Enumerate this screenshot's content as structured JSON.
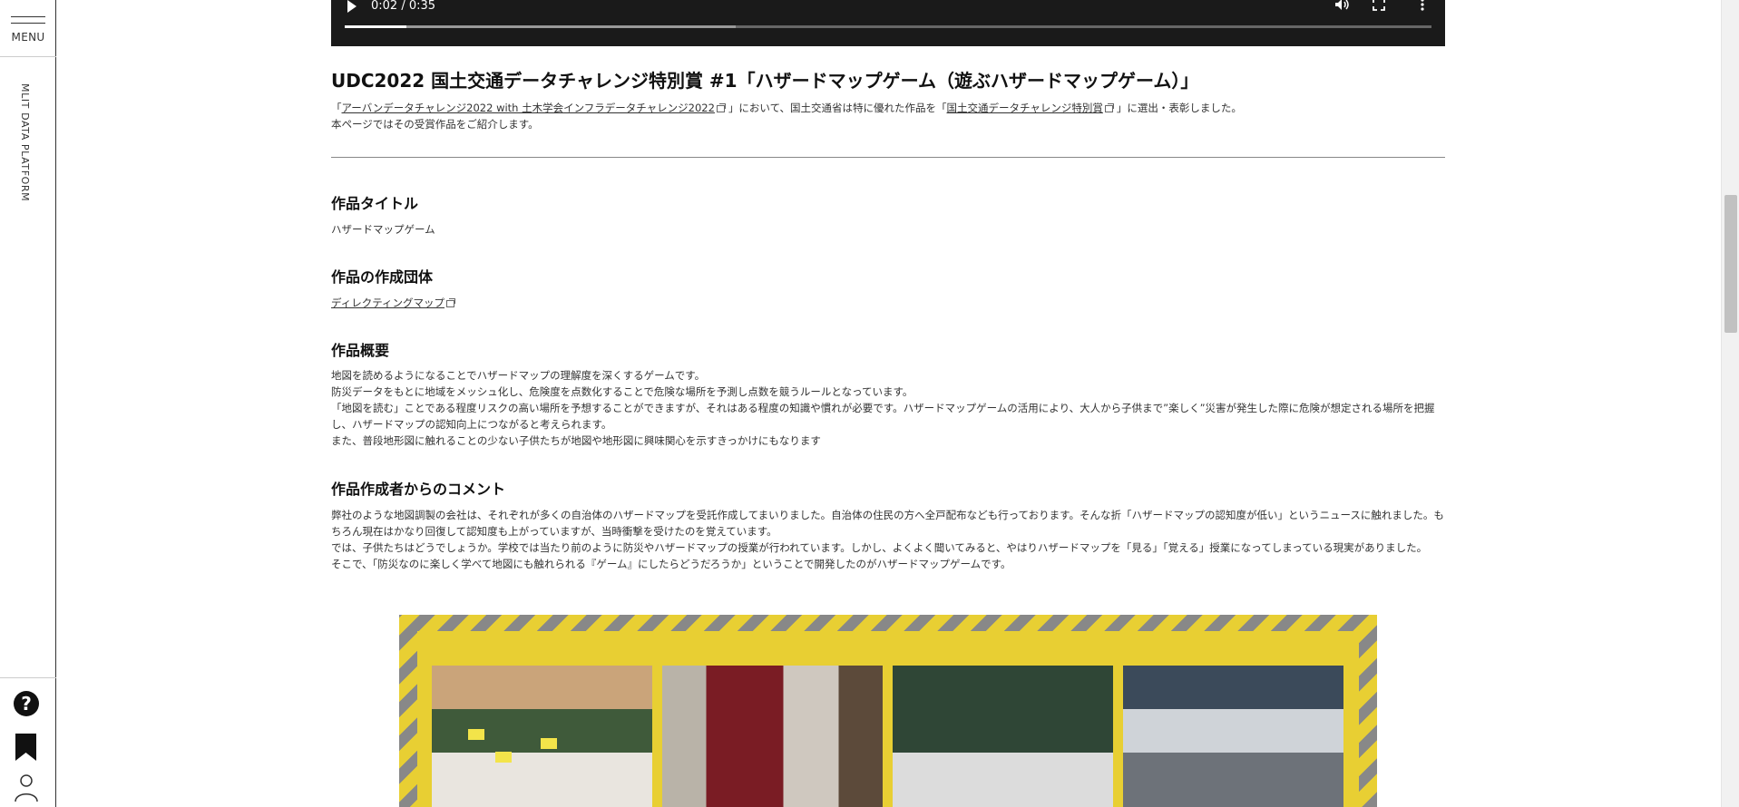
{
  "sidebar": {
    "menu_label": "MENU",
    "platform_label": "MLIT DATA PLATFORM",
    "help_symbol": "?"
  },
  "video": {
    "time": "0:02 / 0:35",
    "progress_fraction": 0.057,
    "buffered_fraction": 0.36
  },
  "page": {
    "title": "UDC2022 国土交通データチャレンジ特別賞 #1「ハザードマップゲーム（遊ぶハザードマップゲーム）」",
    "intro": {
      "prefix": "「",
      "link1": "アーバンデータチャレンジ2022 with 土木学会インフラデータチャレンジ2022",
      "middle": "」において、国土交通省は特に優れた作品を「",
      "link2": "国土交通データチャレンジ特別賞",
      "suffix": "」に選出・表彰しました。",
      "line2": "本ページではその受賞作品をご紹介します。"
    }
  },
  "sections": {
    "title": {
      "heading": "作品タイトル",
      "body": "ハザードマップゲーム"
    },
    "org": {
      "heading": "作品の作成団体",
      "link": "ディレクティングマップ"
    },
    "summary": {
      "heading": "作品概要",
      "lines": [
        "地図を読めるようになることでハザードマップの理解度を深くするゲームです。",
        "防災データをもとに地域をメッシュ化し、危険度を点数化することで危険な場所を予測し点数を競うルールとなっています。",
        "「地図を読む」ことである程度リスクの高い場所を予想することができますが、それはある程度の知識や慣れが必要です。ハザードマップゲームの活用により、大人から子供まで”楽しく”災害が発生した際に危険が想定される場所を把握し、ハザードマップの認知向上につながると考えられます。",
        "また、普段地形図に触れることの少ない子供たちが地図や地形図に興味関心を示すきっかけにもなります"
      ]
    },
    "comment": {
      "heading": "作品作成者からのコメント",
      "lines": [
        "弊社のような地図調製の会社は、それぞれが多くの自治体のハザードマップを受託作成してまいりました。自治体の住民の方へ全戸配布なども行っております。そんな折「ハザードマップの認知度が低い」というニュースに触れました。もちろん現在はかなり回復して認知度も上がっていますが、当時衝撃を受けたのを覚えています。",
        "では、子供たちはどうでしょうか。学校では当たり前のように防災やハザードマップの授業が行われています。しかし、よくよく聞いてみると、やはりハザードマップを「見る」「覚える」授業になってしまっている現実がありました。",
        "そこで、「防災なのに楽しく学べて地図にも触れられる『ゲーム』にしたらどうだろうか」ということで開発したのがハザードマップゲームです。"
      ]
    }
  },
  "colors": {
    "hazard_yellow": "#e8cf33",
    "hazard_gray": "#888888"
  },
  "icons": [
    "play-icon",
    "volume-icon",
    "fullscreen-icon",
    "more-icon",
    "help-icon",
    "bookmark-icon",
    "user-icon",
    "external-link-icon"
  ]
}
